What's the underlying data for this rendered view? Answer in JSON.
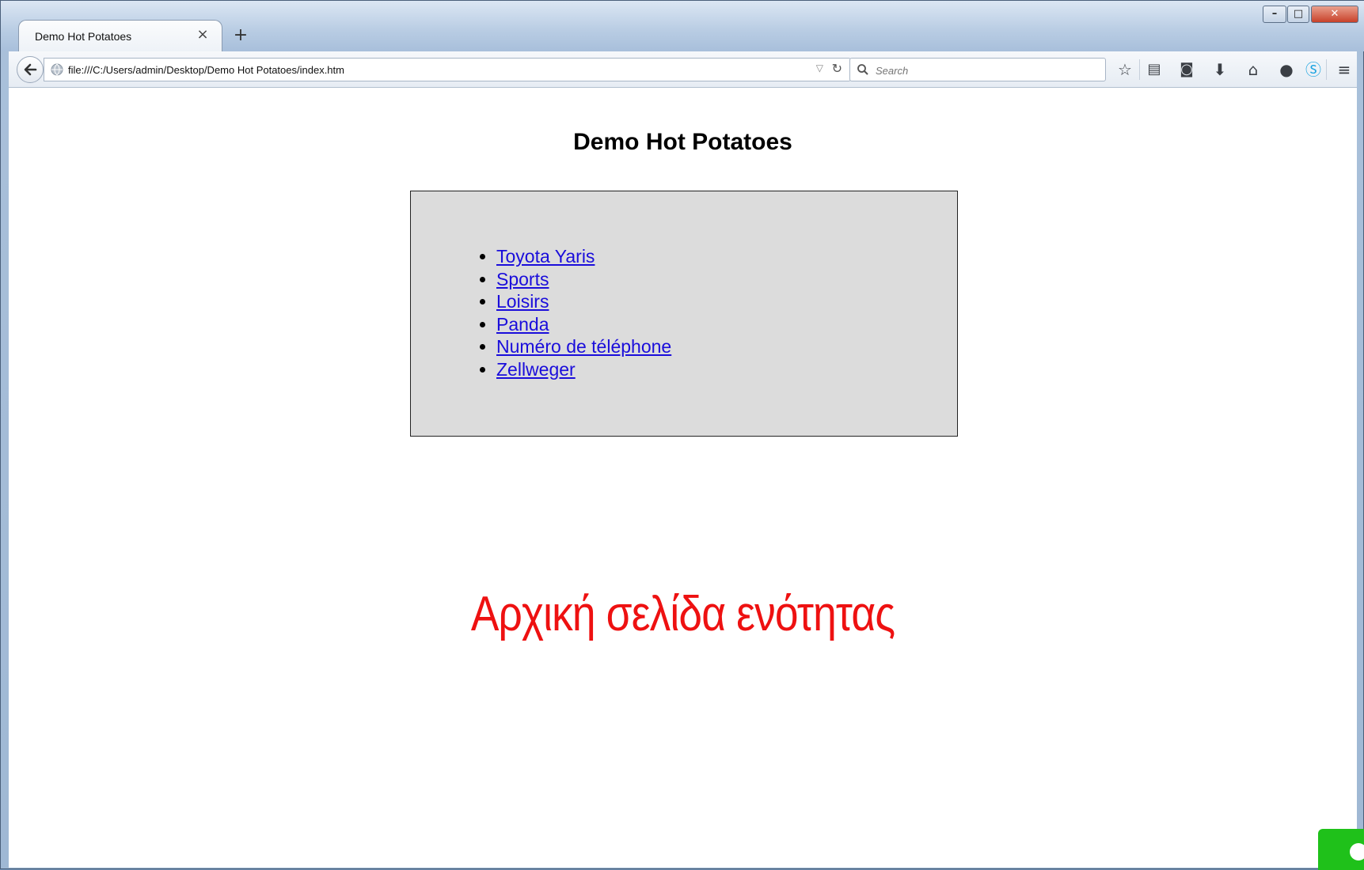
{
  "browser": {
    "tab_title": "Demo Hot Potatoes",
    "tab_close_glyph": "×",
    "new_tab_glyph": "+",
    "url": "file:///C:/Users/admin/Desktop/Demo Hot Potatoes/index.htm",
    "search_placeholder": "Search",
    "window_controls": {
      "minimize": "–",
      "maximize": "□",
      "close": "✕"
    },
    "toolbar_icons": [
      "star-icon",
      "reading-list-icon",
      "pocket-icon",
      "download-icon",
      "home-icon",
      "chat-icon",
      "skype-icon",
      "menu-icon"
    ]
  },
  "page": {
    "title": "Demo Hot Potatoes",
    "links": [
      "Toyota Yaris",
      "Sports",
      "Loisirs",
      "Panda",
      "Numéro de téléphone",
      "Zellweger"
    ],
    "caption": "Αρχική σελίδα ενότητας"
  },
  "colors": {
    "link": "#1a0ddb",
    "caption": "#ee1111",
    "box_bg": "#dcdcdc",
    "chat_widget": "#1fc11a"
  }
}
